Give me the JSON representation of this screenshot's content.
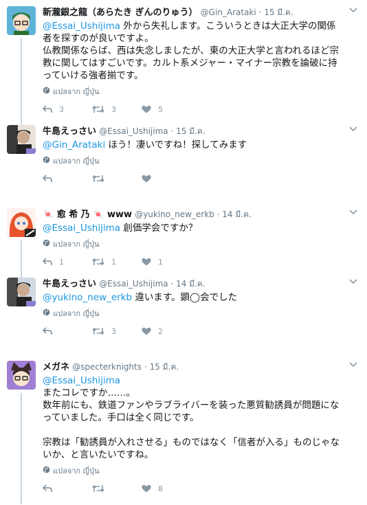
{
  "translate_label": "แปลจาก ญี่ปุ่น",
  "colors": {
    "link": "#1b95e0",
    "muted": "#657786",
    "icon": "#8899a6"
  },
  "groups": [
    {
      "tweets": [
        {
          "name": "新瀧銀之龍（あらたき ぎんのりゅう）",
          "handle": "@Gin_Arataki",
          "time": "15 มี.ค.",
          "mention": "@Essai_Ushijima",
          "text": " 外から失礼します。こういうときは大正大学の関係者を探すのが良いですよ。",
          "lines": [
            "仏教関係ならば、西は失念しましたが、東の大正大学と言われるほど宗教に関してはすごいです。カルト系メジャー・マイナー宗教を論破に持っていける強者揃です。"
          ],
          "replies": "3",
          "retweets": "3",
          "likes": "5"
        },
        {
          "name": "牛島えっさい",
          "handle": "@Essai_Ushijima",
          "time": "15 มี.ค.",
          "mention": "@Gin_Arataki",
          "text": " ほう！凄いですね！探してみます",
          "lines": [],
          "replies": "",
          "retweets": "",
          "likes": ""
        }
      ]
    },
    {
      "tweets": [
        {
          "name": "🍬 愈 希 乃 🍬 www",
          "handle": "@yukino_new_erkb",
          "time": "14 มี.ค.",
          "mention": "@Essai_Ushijima",
          "text": " 創価学会ですか？",
          "lines": [],
          "replies": "1",
          "retweets": "1",
          "likes": "1"
        },
        {
          "name": "牛島えっさい",
          "handle": "@Essai_Ushijima",
          "time": "14 มี.ค.",
          "mention": "@yukino_new_erkb",
          "text": " 違います。顕◯会でした",
          "lines": [],
          "replies": "",
          "retweets": "3",
          "likes": "2"
        }
      ]
    },
    {
      "tweets": [
        {
          "name": "メガネ",
          "handle": "@specterknights",
          "time": "15 มี.ค.",
          "mention": "@Essai_Ushijima",
          "text": "",
          "lines": [
            "またコレですか……。",
            "数年前にも、鉄道ファンやラブライバーを装った悪質勧誘員が問題になっていました。手口は全く同じです。",
            "",
            "宗教は「勧誘員が入れさせる」ものではなく「信者が入る」ものじゃないか、と言いたいですね。"
          ],
          "replies": "",
          "retweets": "",
          "likes": "8"
        }
      ]
    }
  ]
}
